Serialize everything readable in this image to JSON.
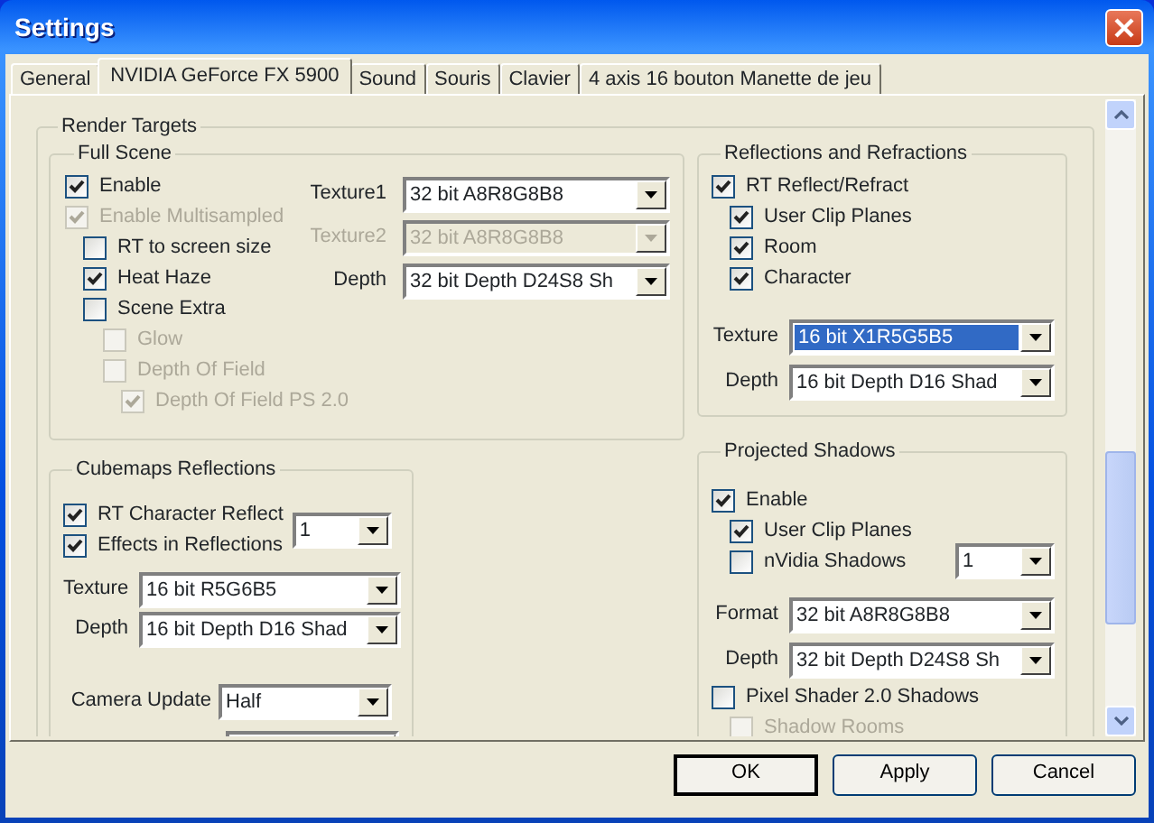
{
  "window": {
    "title": "Settings"
  },
  "tabs": [
    {
      "label": "General",
      "selected": false
    },
    {
      "label": "NVIDIA GeForce FX 5900",
      "selected": true
    },
    {
      "label": "Sound",
      "selected": false
    },
    {
      "label": "Souris",
      "selected": false
    },
    {
      "label": "Clavier",
      "selected": false
    },
    {
      "label": "4 axis 16 bouton Manette de jeu",
      "selected": false
    }
  ],
  "render_targets": {
    "title": "Render Targets",
    "full_scene": {
      "title": "Full Scene",
      "options": [
        {
          "label": "Enable",
          "checked": true,
          "disabled": false
        },
        {
          "label": "Enable Multisampled",
          "checked": true,
          "disabled": true,
          "children": [
            {
              "label": "RT to screen size",
              "checked": false,
              "disabled": false
            },
            {
              "label": "Heat Haze",
              "checked": true,
              "disabled": false
            },
            {
              "label": "Scene Extra",
              "checked": false,
              "disabled": false,
              "children": [
                {
                  "label": "Glow",
                  "checked": false,
                  "disabled": true
                },
                {
                  "label": "Depth Of Field",
                  "checked": false,
                  "disabled": true,
                  "children": [
                    {
                      "label": "Depth Of Field PS 2.0",
                      "checked": true,
                      "disabled": true
                    }
                  ]
                }
              ]
            }
          ]
        }
      ],
      "fields": [
        {
          "label": "Texture1",
          "value": "32 bit A8R8G8B8",
          "disabled": false
        },
        {
          "label": "Texture2",
          "value": "32 bit A8R8G8B8",
          "disabled": true
        },
        {
          "label": "Depth",
          "value": "32 bit Depth D24S8 Sh",
          "disabled": false
        }
      ]
    },
    "reflections": {
      "title": "Reflections and Refractions",
      "options": [
        {
          "label": "RT Reflect/Refract",
          "checked": true,
          "disabled": false,
          "children": [
            {
              "label": "User Clip Planes",
              "checked": true,
              "disabled": false
            },
            {
              "label": "Room",
              "checked": true,
              "disabled": false
            },
            {
              "label": "Character",
              "checked": true,
              "disabled": false
            }
          ]
        }
      ],
      "fields": [
        {
          "label": "Texture",
          "value": "16 bit X1R5G5B5",
          "disabled": false,
          "highlighted": true
        },
        {
          "label": "Depth",
          "value": "16 bit Depth D16 Shad",
          "disabled": false,
          "highlighted": false
        }
      ]
    },
    "cubemaps": {
      "title": "Cubemaps Reflections",
      "options": [
        {
          "label": "RT Character Reflect",
          "checked": true,
          "disabled": false
        },
        {
          "label": "Effects in Reflections",
          "checked": true,
          "disabled": false
        }
      ],
      "count": {
        "value": "1"
      },
      "fields": [
        {
          "label": "Texture",
          "value": "16 bit R5G6B5",
          "disabled": false
        },
        {
          "label": "Depth",
          "value": "16 bit Depth D16 Shad",
          "disabled": false
        }
      ],
      "camera_update": {
        "label": "Camera Update",
        "value": "Half"
      }
    },
    "shadows": {
      "title": "Projected Shadows",
      "options": [
        {
          "label": "Enable",
          "checked": true,
          "disabled": false,
          "children": [
            {
              "label": "User Clip Planes",
              "checked": true,
              "disabled": false
            },
            {
              "label": "nVidia Shadows",
              "checked": false,
              "disabled": false
            }
          ]
        }
      ],
      "count": {
        "value": "1"
      },
      "fields": [
        {
          "label": "Format",
          "value": "32 bit A8R8G8B8",
          "disabled": false
        },
        {
          "label": "Depth",
          "value": "32 bit Depth D24S8 Sh",
          "disabled": false
        }
      ],
      "extra_options": [
        {
          "label": "Pixel Shader 2.0 Shadows",
          "checked": false,
          "disabled": false,
          "children": [
            {
              "label": "Shadow Rooms",
              "checked": false,
              "disabled": true
            }
          ]
        }
      ]
    }
  },
  "buttons": [
    {
      "label": "OK",
      "default": true
    },
    {
      "label": "Apply",
      "default": false
    },
    {
      "label": "Cancel",
      "default": false
    }
  ]
}
